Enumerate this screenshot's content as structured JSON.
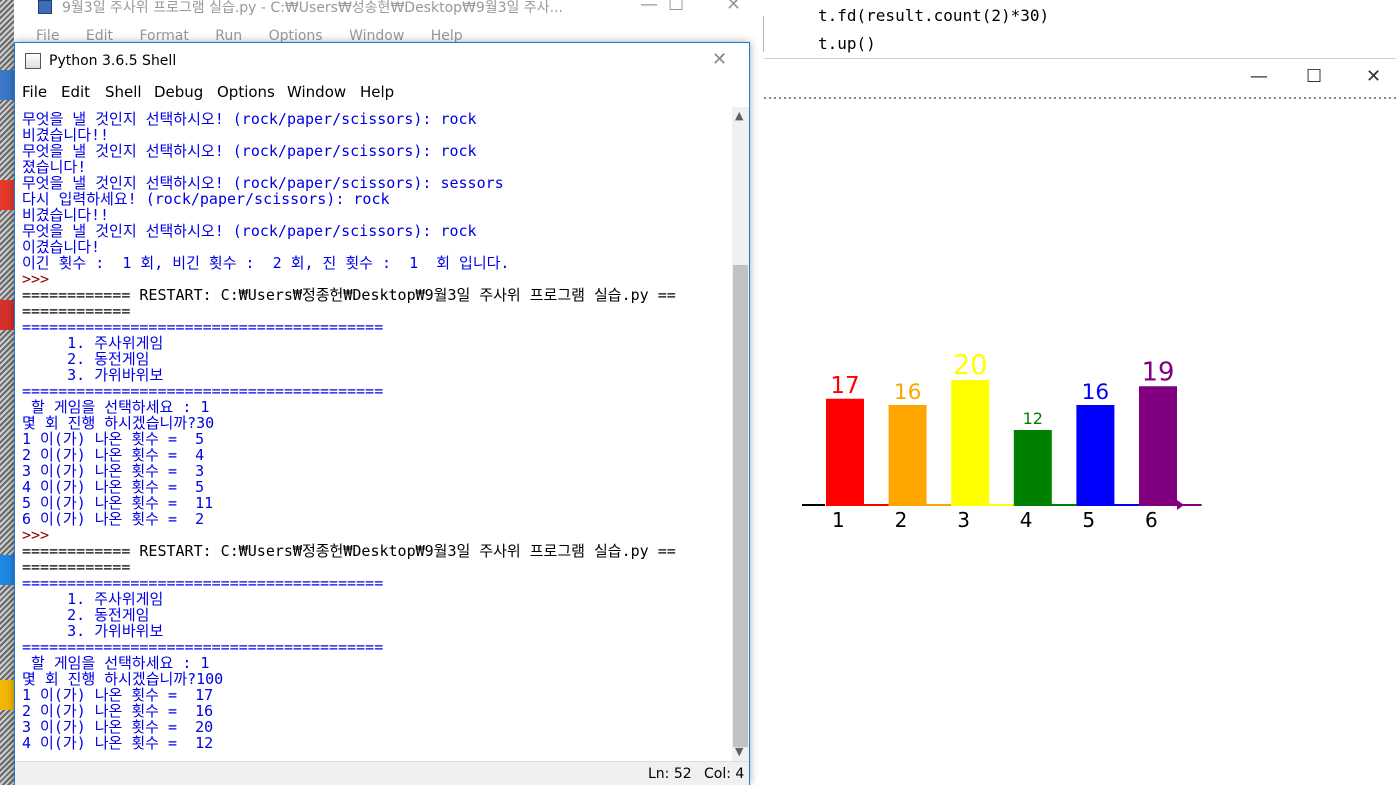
{
  "editor_window": {
    "title": "9월3일 주사위 프로그램 실습.py - C:₩Users₩성송현₩Desktop₩9월3일 주사...",
    "menu": [
      "File",
      "Edit",
      "Format",
      "Run",
      "Options",
      "Window",
      "Help"
    ],
    "minimize": "—",
    "maximize": "☐",
    "close": "✕",
    "code_lines": [
      "t.fd(result.count(2)*30)",
      "t.up()"
    ]
  },
  "turtle_window": {
    "minimize": "—",
    "maximize": "☐",
    "close": "✕"
  },
  "shell_window": {
    "title": "Python 3.6.5 Shell",
    "close": "✕",
    "menu": [
      "File",
      "Edit",
      "Shell",
      "Debug",
      "Options",
      "Window",
      "Help"
    ],
    "status": {
      "line": "Ln: 52",
      "col": "Col: 4"
    },
    "output": [
      {
        "text": "무엇을 낼 것인지 선택하시오! (rock/paper/scissors): rock",
        "color": "blue"
      },
      {
        "text": "비겼습니다!!",
        "color": "blue"
      },
      {
        "text": "무엇을 낼 것인지 선택하시오! (rock/paper/scissors): rock",
        "color": "blue"
      },
      {
        "text": "졌습니다!",
        "color": "blue"
      },
      {
        "text": "무엇을 낼 것인지 선택하시오! (rock/paper/scissors): sessors",
        "color": "blue"
      },
      {
        "text": "다시 입력하세요! (rock/paper/scissors): rock",
        "color": "blue"
      },
      {
        "text": "비겼습니다!!",
        "color": "blue"
      },
      {
        "text": "무엇을 낼 것인지 선택하시오! (rock/paper/scissors): rock",
        "color": "blue"
      },
      {
        "text": "이겼습니다!",
        "color": "blue"
      },
      {
        "text": "이긴 횟수 :  1 회, 비긴 횟수 :  2 회, 진 횟수 :  1  회 입니다.",
        "color": "blue"
      },
      {
        "text": ">>> ",
        "color": "dred"
      },
      {
        "text": "============ RESTART: C:₩Users₩정종헌₩Desktop₩9월3일 주사위 프로그램 실습.py ==",
        "color": "black"
      },
      {
        "text": "============",
        "color": "black"
      },
      {
        "text": "========================================",
        "color": "blue"
      },
      {
        "text": "     1. 주사위게임",
        "color": "blue"
      },
      {
        "text": "     2. 동전게임",
        "color": "blue"
      },
      {
        "text": "     3. 가위바위보",
        "color": "blue"
      },
      {
        "text": "========================================",
        "color": "blue"
      },
      {
        "text": " 할 게임을 선택하세요 : 1",
        "color": "blue"
      },
      {
        "text": "몇 회 진행 하시겠습니까?30",
        "color": "blue"
      },
      {
        "text": "1 이(가) 나온 횟수 =  5",
        "color": "blue"
      },
      {
        "text": "2 이(가) 나온 횟수 =  4",
        "color": "blue"
      },
      {
        "text": "3 이(가) 나온 횟수 =  3",
        "color": "blue"
      },
      {
        "text": "4 이(가) 나온 횟수 =  5",
        "color": "blue"
      },
      {
        "text": "5 이(가) 나온 횟수 =  11",
        "color": "blue"
      },
      {
        "text": "6 이(가) 나온 횟수 =  2",
        "color": "blue"
      },
      {
        "text": ">>> ",
        "color": "dred"
      },
      {
        "text": "============ RESTART: C:₩Users₩정종헌₩Desktop₩9월3일 주사위 프로그램 실습.py ==",
        "color": "black"
      },
      {
        "text": "============",
        "color": "black"
      },
      {
        "text": "========================================",
        "color": "blue"
      },
      {
        "text": "     1. 주사위게임",
        "color": "blue"
      },
      {
        "text": "     2. 동전게임",
        "color": "blue"
      },
      {
        "text": "     3. 가위바위보",
        "color": "blue"
      },
      {
        "text": "========================================",
        "color": "blue"
      },
      {
        "text": " 할 게임을 선택하세요 : 1",
        "color": "blue"
      },
      {
        "text": "몇 회 진행 하시겠습니까?100",
        "color": "blue"
      },
      {
        "text": "1 이(가) 나온 횟수 =  17",
        "color": "blue"
      },
      {
        "text": "2 이(가) 나온 횟수 =  16",
        "color": "blue"
      },
      {
        "text": "3 이(가) 나온 횟수 =  20",
        "color": "blue"
      },
      {
        "text": "4 이(가) 나온 횟수 =  12",
        "color": "blue"
      }
    ]
  },
  "colors": {
    "shell_border": "#1e78d6",
    "prompt": "#8b0000",
    "output_blue": "#0000e6"
  },
  "chart_data": {
    "type": "bar",
    "categories": [
      "1",
      "2",
      "3",
      "4",
      "5",
      "6"
    ],
    "values": [
      17,
      16,
      20,
      12,
      16,
      19
    ],
    "colors": [
      "#ff0000",
      "#ffa500",
      "#ffff00",
      "#008000",
      "#0000ff",
      "#800080"
    ],
    "value_labels": [
      "17",
      "16",
      "20",
      "12",
      "16",
      "19"
    ],
    "title": "",
    "xlabel": "",
    "ylabel": "",
    "ylim": [
      0,
      20
    ]
  }
}
